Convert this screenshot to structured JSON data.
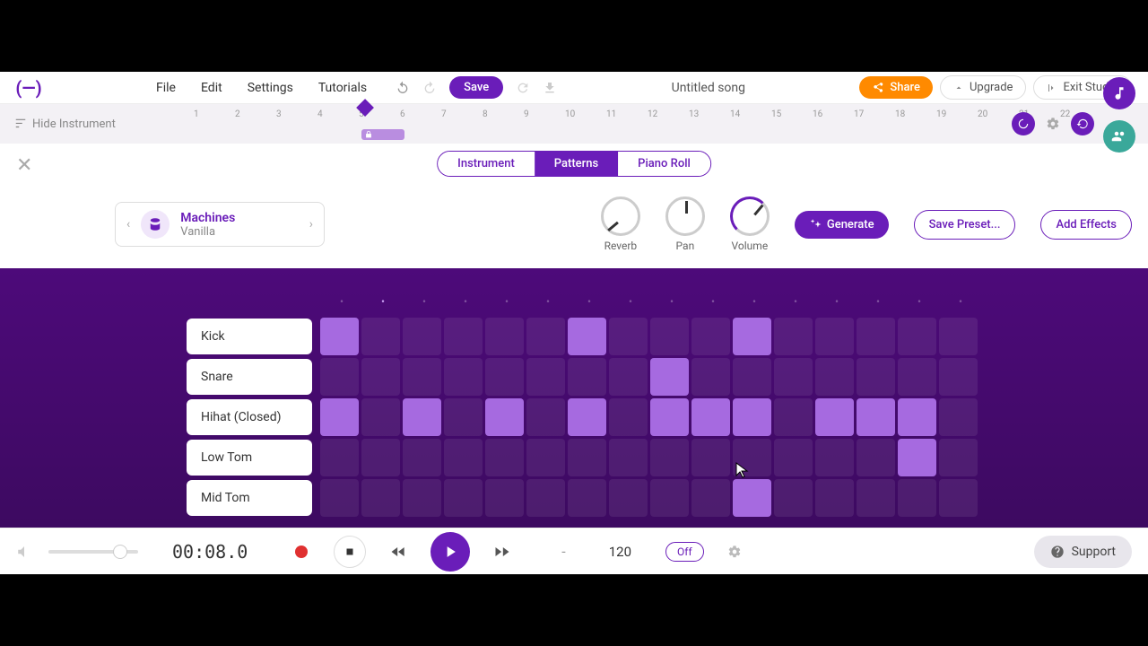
{
  "menu": {
    "file": "File",
    "edit": "Edit",
    "settings": "Settings",
    "tutorials": "Tutorials"
  },
  "toolbar": {
    "save": "Save",
    "song_title": "Untitled song",
    "share": "Share",
    "upgrade": "Upgrade",
    "exit": "Exit Studio"
  },
  "timeline": {
    "hide_instrument": "Hide Instrument",
    "ticks": [
      "1",
      "2",
      "3",
      "4",
      "5",
      "6",
      "7",
      "8",
      "9",
      "10",
      "11",
      "12",
      "13",
      "14",
      "15",
      "16",
      "17",
      "18",
      "19",
      "20",
      "21",
      "22"
    ]
  },
  "tabs": {
    "instrument": "Instrument",
    "patterns": "Patterns",
    "piano_roll": "Piano Roll"
  },
  "instrument": {
    "name": "Machines",
    "preset": "Vanilla"
  },
  "knobs": {
    "reverb": "Reverb",
    "pan": "Pan",
    "volume": "Volume"
  },
  "actions": {
    "generate": "Generate",
    "save_preset": "Save Preset...",
    "add_effects": "Add Effects"
  },
  "tracks": [
    {
      "label": "Kick",
      "cells": [
        1,
        0,
        0,
        0,
        0,
        0,
        1,
        0,
        0,
        0,
        1,
        0,
        0,
        0,
        0,
        0
      ]
    },
    {
      "label": "Snare",
      "cells": [
        0,
        0,
        0,
        0,
        0,
        0,
        0,
        0,
        1,
        0,
        0,
        0,
        0,
        0,
        0,
        0
      ]
    },
    {
      "label": "Hihat (Closed)",
      "cells": [
        1,
        0,
        1,
        0,
        1,
        0,
        1,
        0,
        1,
        1,
        1,
        0,
        1,
        1,
        1,
        0
      ]
    },
    {
      "label": "Low Tom",
      "cells": [
        0,
        0,
        0,
        0,
        0,
        0,
        0,
        0,
        0,
        0,
        0,
        0,
        0,
        0,
        1,
        0
      ]
    },
    {
      "label": "Mid Tom",
      "cells": [
        0,
        0,
        0,
        0,
        0,
        0,
        0,
        0,
        0,
        0,
        1,
        0,
        0,
        0,
        0,
        0
      ]
    }
  ],
  "transport": {
    "time": "00:08.0",
    "dash": "-",
    "bpm": "120",
    "metronome": "Off"
  },
  "support": {
    "label": "Support"
  }
}
